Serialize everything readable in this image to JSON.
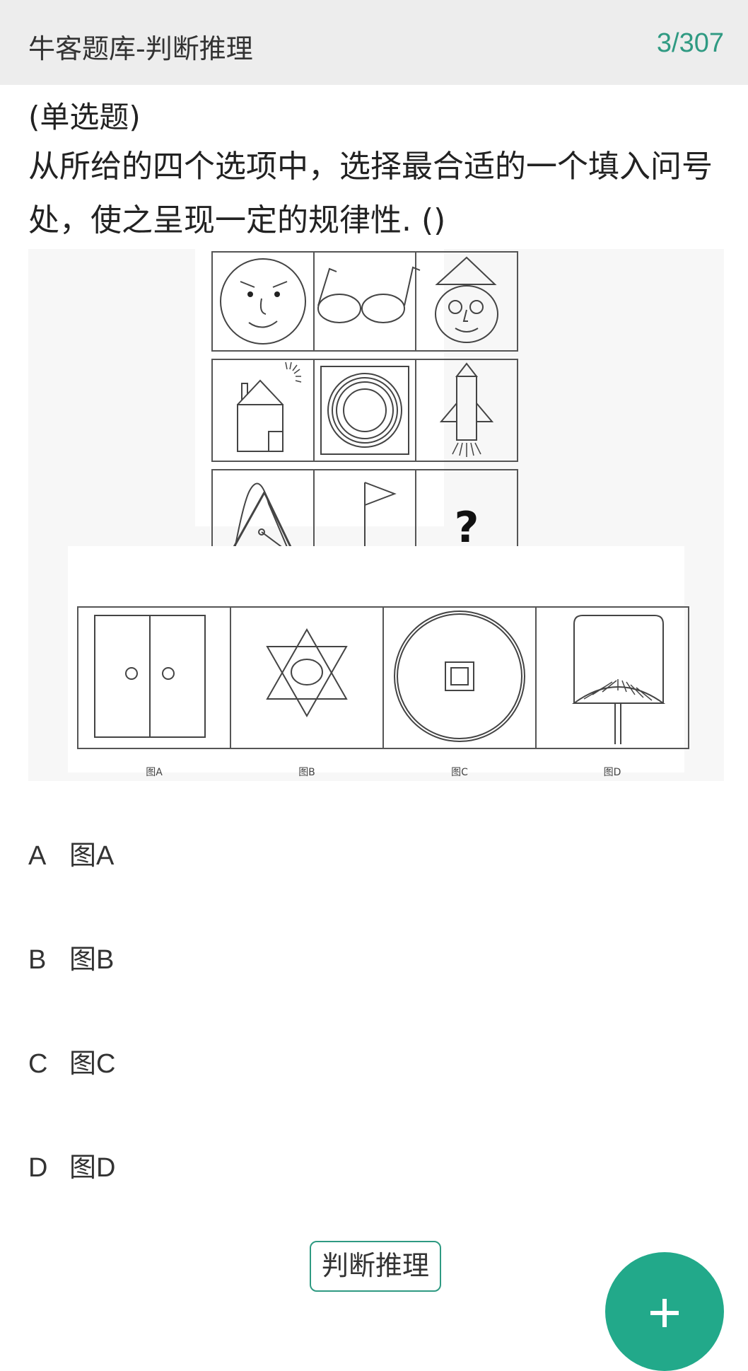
{
  "header": {
    "title": "牛客题库-判断推理",
    "counter": "3/307"
  },
  "question": {
    "type": "(单选题)",
    "text": "从所给的四个选项中，选择最合适的一个填入问号处，使之呈现一定的规律性. ()"
  },
  "figure": {
    "missing_mark": "?",
    "captions": [
      "图A",
      "图B",
      "图C",
      "图D"
    ]
  },
  "options": [
    {
      "letter": "A",
      "label": "图A"
    },
    {
      "letter": "B",
      "label": "图B"
    },
    {
      "letter": "C",
      "label": "图C"
    },
    {
      "letter": "D",
      "label": "图D"
    }
  ],
  "category_tag": "判断推理",
  "fab": {
    "icon": "plus-icon"
  },
  "colors": {
    "accent": "#22a98a",
    "counter": "#2f9a82",
    "header_bg": "#ededed"
  }
}
